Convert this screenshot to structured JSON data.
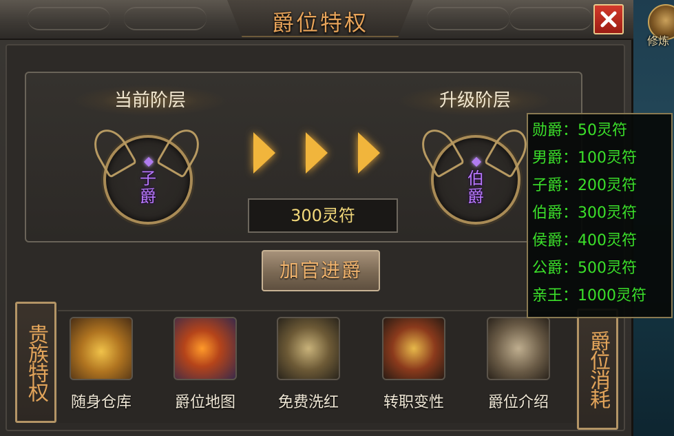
{
  "window": {
    "title": "爵位特权",
    "close_symbol": "✕"
  },
  "background_hud": {
    "label": "修炼"
  },
  "upgrade": {
    "current_label": "当前阶层",
    "next_label": "升级阶层",
    "current_rank": [
      "子",
      "爵"
    ],
    "next_rank": [
      "伯",
      "爵"
    ],
    "cost": "300灵符",
    "promote_button": "加官进爵"
  },
  "tabs": {
    "left": "贵族特权",
    "right": "爵位消耗"
  },
  "features": [
    {
      "label": "随身仓库",
      "icon": "treasure-chest-icon"
    },
    {
      "label": "爵位地图",
      "icon": "map-scroll-icon"
    },
    {
      "label": "免费洗红",
      "icon": "crossed-swords-icon"
    },
    {
      "label": "转职变性",
      "icon": "helmet-icon"
    },
    {
      "label": "爵位介绍",
      "icon": "book-icon"
    }
  ],
  "tooltip": {
    "rows": [
      "勋爵：50灵符",
      "男爵：100灵符",
      "子爵：200灵符",
      "伯爵：300灵符",
      "侯爵：400灵符",
      "公爵：500灵符",
      "亲王：1000灵符"
    ]
  },
  "colors": {
    "title": "#e6a35a",
    "rank_text": "#b978ff",
    "cost_text": "#f2d87a",
    "tooltip_text": "#3be02a",
    "close_button": "#c02a1f"
  }
}
